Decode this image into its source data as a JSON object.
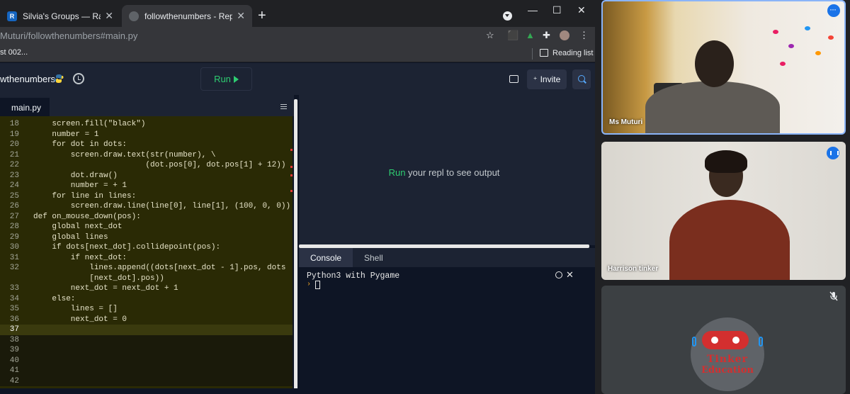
{
  "browser": {
    "tabs": [
      {
        "title": "Silvia's Groups — Ratatype",
        "favicon": "R",
        "active": false
      },
      {
        "title": "followthenumbers - Replit",
        "favicon": "",
        "active": true
      }
    ],
    "url": "Muturi/followthenumbers#main.py",
    "bookmark": "st 002...",
    "reading_list": "Reading list",
    "window_controls": {
      "minimize": "—",
      "maximize": "☐",
      "close": "✕"
    }
  },
  "replit": {
    "repl_name": "wthenumbers",
    "run_label": "Run",
    "invite_label": "Invite",
    "file_tab": "main.py",
    "output_prefix": "Run",
    "output_message": " your repl to see output",
    "console_tabs": [
      "Console",
      "Shell"
    ],
    "console_header": "Python3 with Pygame",
    "prompt": "›"
  },
  "code_lines": [
    {
      "n": "18",
      "t": "    screen.fill(\"black\")"
    },
    {
      "n": "19",
      "t": "    number = 1"
    },
    {
      "n": "20",
      "t": "    for dot in dots:"
    },
    {
      "n": "21",
      "t": "        screen.draw.text(str(number), \\"
    },
    {
      "n": "22",
      "t": "                        (dot.pos[0], dot.pos[1] + 12))"
    },
    {
      "n": "23",
      "t": "        dot.draw()"
    },
    {
      "n": "24",
      "t": "        number = + 1"
    },
    {
      "n": "25",
      "t": "    for line in lines:"
    },
    {
      "n": "26",
      "t": "        screen.draw.line(line[0], line[1], (100, 0, 0))"
    },
    {
      "n": "27",
      "t": "def on_mouse_down(pos):"
    },
    {
      "n": "28",
      "t": "    global next_dot"
    },
    {
      "n": "29",
      "t": "    global lines"
    },
    {
      "n": "30",
      "t": "    if dots[next_dot].collidepoint(pos):"
    },
    {
      "n": "31",
      "t": "        if next_dot:"
    },
    {
      "n": "32",
      "t": "            lines.append((dots[next_dot - 1].pos, dots"
    },
    {
      "n": "",
      "t": "            [next_dot].pos))"
    },
    {
      "n": "33",
      "t": "        next_dot = next_dot + 1"
    },
    {
      "n": "34",
      "t": "    else:"
    },
    {
      "n": "35",
      "t": "        lines = []"
    },
    {
      "n": "36",
      "t": "        next_dot = 0"
    },
    {
      "n": "37",
      "t": ""
    },
    {
      "n": "38",
      "t": ""
    },
    {
      "n": "39",
      "t": ""
    },
    {
      "n": "40",
      "t": ""
    },
    {
      "n": "41",
      "t": ""
    },
    {
      "n": "42",
      "t": ""
    }
  ],
  "meet": {
    "participants": [
      {
        "name": "Ms Muturi"
      },
      {
        "name": "Harrison tinker"
      },
      {
        "name": ""
      }
    ],
    "logo": {
      "line1": "Tinker",
      "line2": "Education"
    }
  },
  "colors": {
    "replit_green": "#2ecc71",
    "replit_bg": "#0e1525",
    "meet_blue": "#1a73e8",
    "logo_red": "#d32f2f"
  }
}
